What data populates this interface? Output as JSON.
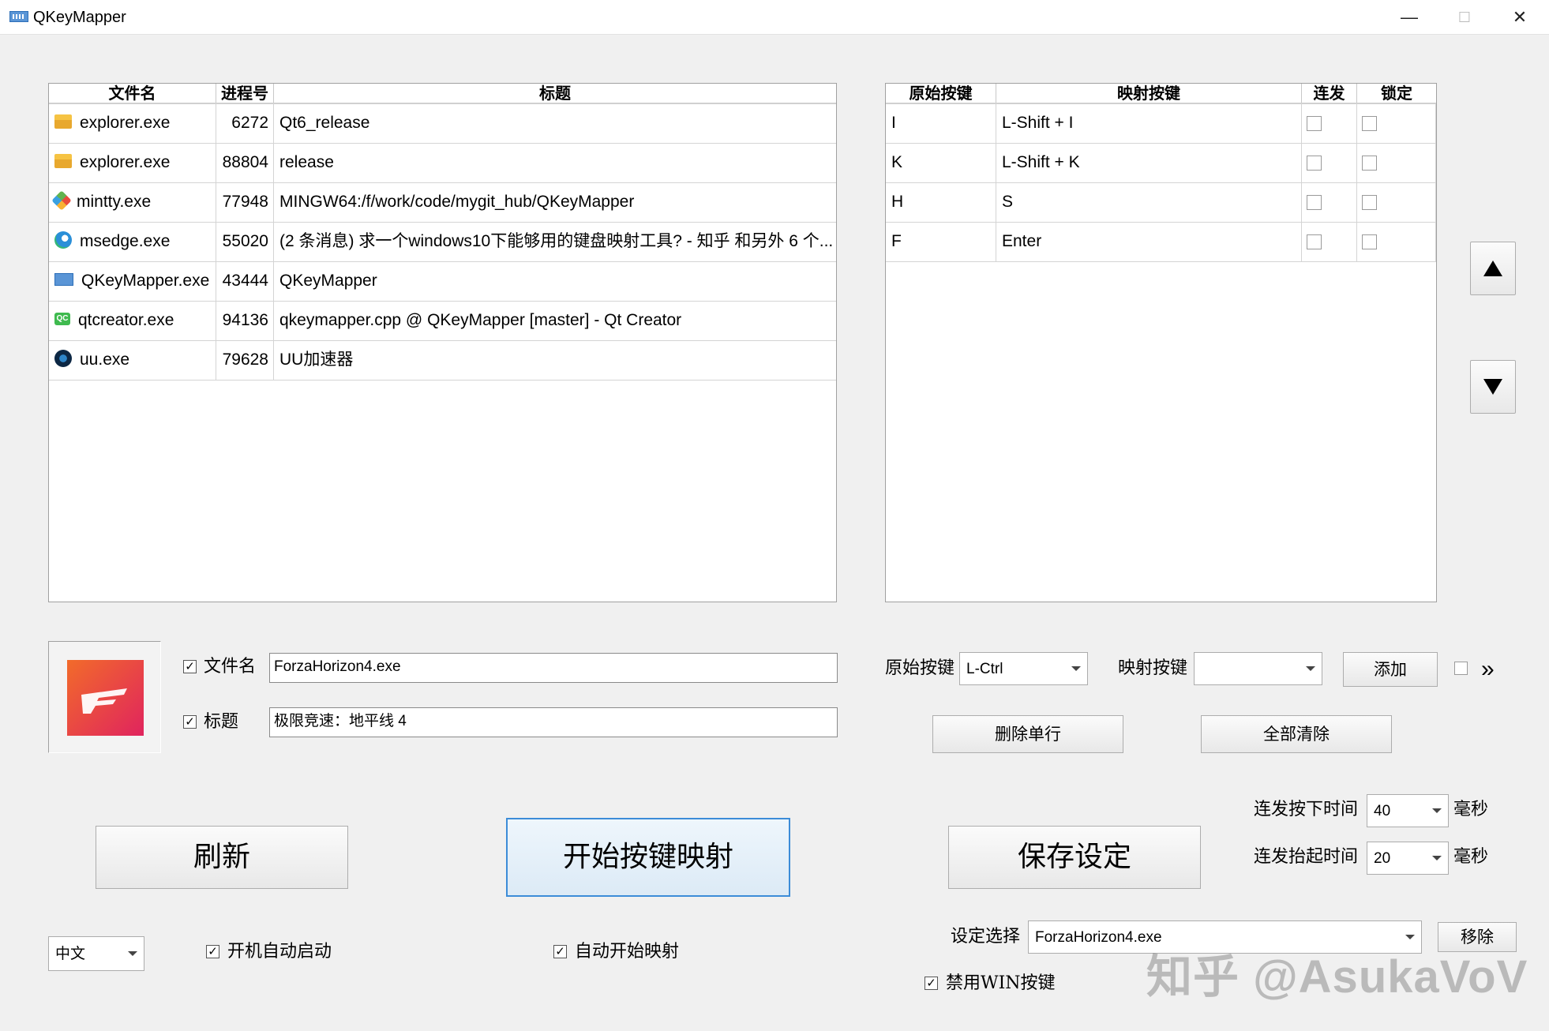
{
  "window": {
    "title": "QKeyMapper",
    "minimize_glyph": "—",
    "maximize_glyph": "☐",
    "close_glyph": "✕"
  },
  "process_table": {
    "headers": [
      "文件名",
      "进程号",
      "标题"
    ],
    "rows": [
      {
        "icon": "folder-icon",
        "file": "explorer.exe",
        "pid": "6272",
        "title": "Qt6_release"
      },
      {
        "icon": "folder-icon",
        "file": "explorer.exe",
        "pid": "88804",
        "title": "release"
      },
      {
        "icon": "git-icon",
        "file": "mintty.exe",
        "pid": "77948",
        "title": "MINGW64:/f/work/code/mygit_hub/QKeyMapper"
      },
      {
        "icon": "edge-icon",
        "file": "msedge.exe",
        "pid": "55020",
        "title": "(2 条消息) 求一个windows10下能够用的键盘映射工具? - 知乎 和另外 6 个..."
      },
      {
        "icon": "keyboard-icon",
        "file": "QKeyMapper.exe",
        "pid": "43444",
        "title": "QKeyMapper"
      },
      {
        "icon": "qt-icon",
        "file": "qtcreator.exe",
        "pid": "94136",
        "title": "qkeymapper.cpp @ QKeyMapper [master] - Qt Creator"
      },
      {
        "icon": "uu-icon",
        "file": "uu.exe",
        "pid": "79628",
        "title": "UU加速器"
      }
    ]
  },
  "mapping_table": {
    "headers": [
      "原始按键",
      "映射按键",
      "连发",
      "锁定"
    ],
    "rows": [
      {
        "original": "I",
        "mapped": "L-Shift + I",
        "burst": false,
        "lock": false
      },
      {
        "original": "K",
        "mapped": "L-Shift + K",
        "burst": false,
        "lock": false
      },
      {
        "original": "H",
        "mapped": "S",
        "burst": false,
        "lock": false
      },
      {
        "original": "F",
        "mapped": "Enter",
        "burst": false,
        "lock": false
      }
    ]
  },
  "selection": {
    "filename_checked": true,
    "filename_label": "文件名",
    "filename_value": "ForzaHorizon4.exe",
    "title_checked": true,
    "title_label": "标题",
    "title_value": "极限竞速：地平线 4"
  },
  "key_editor": {
    "original_label": "原始按键",
    "original_value": "L-Ctrl",
    "mapped_label": "映射按键",
    "mapped_value": "",
    "add_button": "添加",
    "extra_checked": false,
    "more_glyph": "»",
    "delete_row_button": "删除单行",
    "clear_all_button": "全部清除"
  },
  "burst": {
    "press_label": "连发按下时间",
    "press_value": "40",
    "release_label": "连发抬起时间",
    "release_value": "20",
    "unit": "毫秒"
  },
  "actions": {
    "refresh": "刷新",
    "start": "开始按键映射",
    "save": "保存设定"
  },
  "bottom": {
    "language": "中文",
    "autostart_checked": true,
    "autostart_label": "开机自动启动",
    "automap_checked": true,
    "automap_label": "自动开始映射",
    "setting_label": "设定选择",
    "setting_value": "ForzaHorizon4.exe",
    "remove_button": "移除",
    "disable_win_checked": true,
    "disable_win_label": "禁用WIN按键"
  },
  "watermark": "知乎 @AsukaVoV",
  "colors": {
    "accent": "#3c8cd8",
    "forza_gradient_start": "#f26b2a",
    "forza_gradient_end": "#e0245e"
  }
}
